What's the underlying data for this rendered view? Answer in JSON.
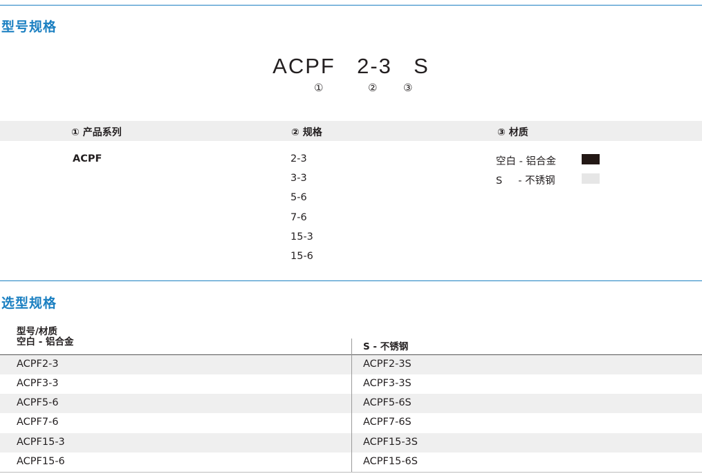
{
  "specs_section": {
    "title": "型号规格",
    "model_parts": [
      "ACPF",
      "2-3",
      "S"
    ],
    "markers": [
      "①",
      "②",
      "③"
    ],
    "headers": [
      "① 产品系列",
      "② 规格",
      "③ 材质"
    ],
    "series": [
      "ACPF"
    ],
    "sizes": [
      "2-3",
      "3-3",
      "5-6",
      "7-6",
      "15-3",
      "15-6"
    ],
    "materials": [
      {
        "label": "空白 - 铝合金",
        "swatch_color": "#231815"
      },
      {
        "label": "S     - 不锈钢",
        "swatch_color": "#e6e6e6"
      }
    ]
  },
  "selection_section": {
    "title": "选型规格",
    "header_left_line1": "型号/材质",
    "header_left_line2": "空白 - 铝合金",
    "header_right": "S - 不锈钢",
    "rows": [
      {
        "aluminum": "ACPF2-3",
        "stainless": "ACPF2-3S"
      },
      {
        "aluminum": "ACPF3-3",
        "stainless": "ACPF3-3S"
      },
      {
        "aluminum": "ACPF5-6",
        "stainless": "ACPF5-6S"
      },
      {
        "aluminum": "ACPF7-6",
        "stainless": "ACPF7-6S"
      },
      {
        "aluminum": "ACPF15-3",
        "stainless": "ACPF15-3S"
      },
      {
        "aluminum": "ACPF15-6",
        "stainless": "ACPF15-6S"
      }
    ]
  },
  "colors": {
    "accent": "#1a7fc1",
    "header_bg": "#eeeeee",
    "row_shade": "#efefef"
  }
}
